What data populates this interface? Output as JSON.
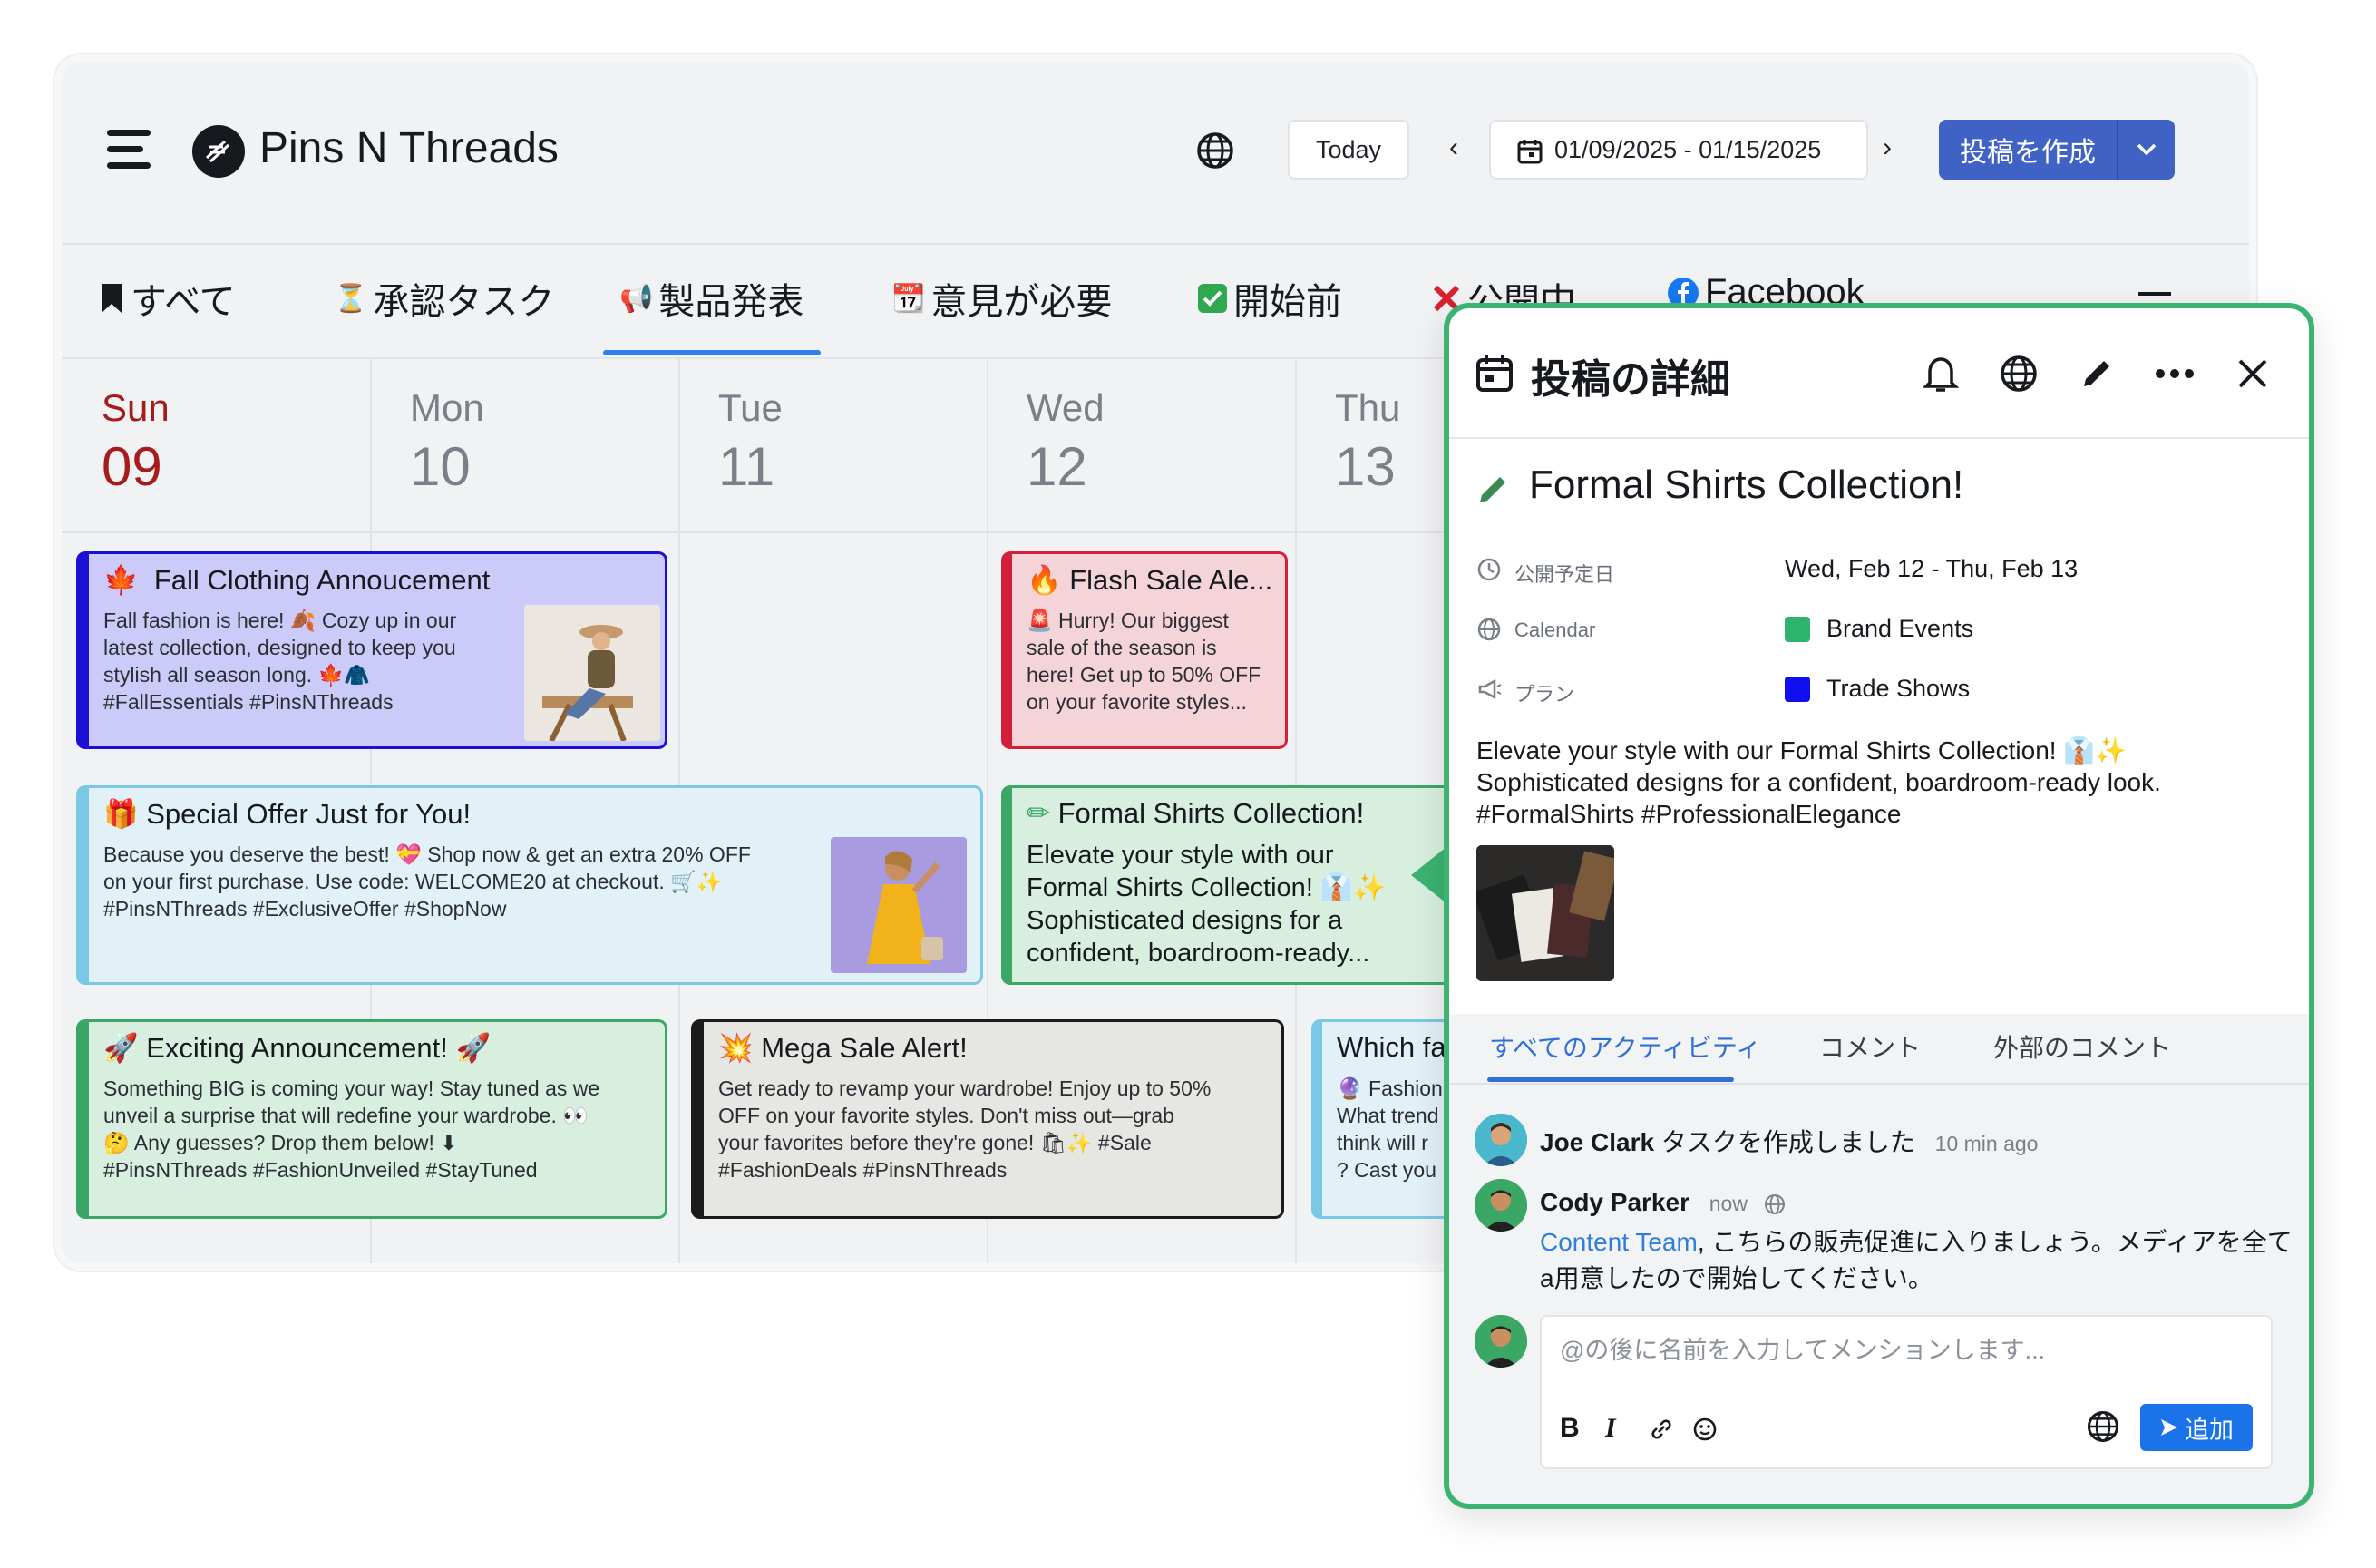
{
  "app": {
    "title": "Pins N Threads"
  },
  "toolbar": {
    "today_label": "Today",
    "date_range": "01/09/2025 - 01/15/2025",
    "create_label": "投稿を作成",
    "prev_label": "‹",
    "next_label": "›"
  },
  "tabs": [
    {
      "icon": "bookmark-icon",
      "label": "すべて"
    },
    {
      "icon": "hourglass-icon",
      "label": "承認タスク"
    },
    {
      "icon": "megaphone-icon",
      "label": "製品発表"
    },
    {
      "icon": "calendar-icon",
      "label": "意見が必要"
    },
    {
      "icon": "check-icon",
      "label": "開始前"
    },
    {
      "icon": "cross-icon",
      "label": "公開中"
    },
    {
      "icon": "facebook-icon",
      "label": "Facebook"
    }
  ],
  "days": [
    {
      "name": "Sun",
      "num": "09"
    },
    {
      "name": "Mon",
      "num": "10"
    },
    {
      "name": "Tue",
      "num": "11"
    },
    {
      "name": "Wed",
      "num": "12"
    },
    {
      "name": "Thu",
      "num": "13"
    }
  ],
  "cards": [
    {
      "title": "Fall Clothing Annoucement",
      "emoji": "🍁",
      "body": [
        "Fall fashion is here! 🍂 Cozy up in our",
        "latest collection, designed to keep you",
        "stylish all season long. 🍁🧥",
        "#FallEssentials #PinsNThreads"
      ]
    },
    {
      "title": "Flash Sale Ale...",
      "emoji": "🔥",
      "body": [
        "🚨 Hurry! Our biggest",
        "sale of the season is",
        "here! Get up to 50% OFF",
        "on your favorite styles..."
      ]
    },
    {
      "title": "Special Offer Just for You!",
      "emoji": "🎁",
      "body": [
        "Because you deserve the best! 💝 Shop now & get an extra 20% OFF",
        "on your first purchase. Use code: WELCOME20 at checkout. 🛒✨",
        "#PinsNThreads #ExclusiveOffer #ShopNow"
      ]
    },
    {
      "title": "Formal Shirts Collection!",
      "emoji": "✏",
      "body": [
        "Elevate your style with our",
        "Formal Shirts Collection! 👔✨",
        "Sophisticated designs for a",
        "confident, boardroom-ready..."
      ]
    },
    {
      "title": "Exciting Announcement! 🚀",
      "emoji": "🚀",
      "body": [
        "Something BIG is coming your way! Stay tuned as we",
        "unveil a surprise that will redefine your wardrobe. 👀",
        "🤔 Any guesses? Drop them below! ⬇",
        "#PinsNThreads #FashionUnveiled #StayTuned"
      ]
    },
    {
      "title": "Mega Sale Alert!",
      "emoji": "💥",
      "body": [
        "Get ready to revamp your wardrobe! Enjoy up to 50%",
        "OFF on your favorite styles. Don't miss out—grab",
        "your favorites before they're gone! 🛍✨    #Sale",
        "#FashionDeals #PinsNThreads"
      ]
    },
    {
      "title": "Which fa",
      "emoji": "",
      "body": [
        "🔮 Fashion",
        "What trend",
        "think will r",
        "? Cast you"
      ]
    }
  ],
  "panel": {
    "title": "投稿の詳細",
    "post_title": "Formal Shirts Collection!",
    "meta": [
      {
        "label": "公開予定日",
        "value": "Wed, Feb 12 - Thu, Feb 13"
      },
      {
        "label": "Calendar",
        "value": "Brand Events",
        "color": "#2db36b"
      },
      {
        "label": "プラン",
        "value": "Trade Shows",
        "color": "#1010ee"
      }
    ],
    "description": [
      "Elevate your style with our Formal Shirts Collection! 👔✨",
      "Sophisticated designs for a confident, boardroom-ready look.",
      "#FormalShirts #ProfessionalElegance"
    ],
    "activity_tabs": [
      "すべてのアクティビティ",
      "コメント",
      "外部のコメント"
    ],
    "activities": [
      {
        "user": "Joe Clark",
        "action": "タスクを作成しました",
        "time": "10 min ago"
      },
      {
        "user": "Cody Parker",
        "time": "now",
        "mention": "Content Team",
        "text_1": ", こちらの販売促進に入りましょう。メディアを全て",
        "text_2": "a用意したので開始してください。"
      }
    ],
    "comment_placeholder": "@の後に名前を入力してメンションします...",
    "add_label": "追加"
  },
  "colors": {
    "accent": "#3f62c4",
    "panel_border": "#3cb371",
    "card_purple_bg": "#cccaf8",
    "card_purple_border": "#1c10d6",
    "card_red_bg": "#f4d3d9",
    "card_red_border": "#d41f3a",
    "card_blue_bg": "#e2f1f7",
    "card_blue_border": "#79c8e6",
    "card_green_bg": "#d8efe0",
    "card_green_border": "#3aa765",
    "card_gray_bg": "#e6e6e3",
    "card_gray_border": "#1b1b1b"
  }
}
